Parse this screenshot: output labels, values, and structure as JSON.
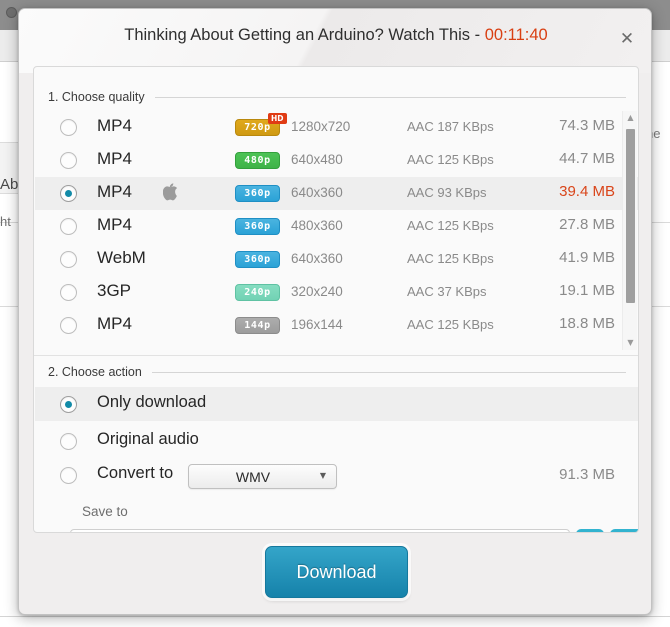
{
  "background": {
    "fragment_left_1": "Ab",
    "fragment_left_2": "ht",
    "fragment_right": "ne"
  },
  "dialog": {
    "title_text": "Thinking About Getting an Arduino? Watch This - ",
    "duration": "00:11:40",
    "close_icon": "✕",
    "accent_color": "#1682aa",
    "highlight_color": "#d9451a"
  },
  "quality_section": {
    "header": "1. Choose quality",
    "rows": [
      {
        "format": "MP4",
        "apple": false,
        "badge": "720p",
        "badge_style": "gold",
        "hd": "HD",
        "resolution": "1280x720",
        "codec": "AAC 187  KBps",
        "size": "74.3 MB",
        "selected": false
      },
      {
        "format": "MP4",
        "apple": false,
        "badge": "480p",
        "badge_style": "green",
        "hd": "",
        "resolution": "640x480",
        "codec": "AAC 125  KBps",
        "size": "44.7 MB",
        "selected": false
      },
      {
        "format": "MP4",
        "apple": true,
        "badge": "360p",
        "badge_style": "blue",
        "hd": "",
        "resolution": "640x360",
        "codec": "AAC 93  KBps",
        "size": "39.4 MB",
        "selected": true
      },
      {
        "format": "MP4",
        "apple": false,
        "badge": "360p",
        "badge_style": "blue",
        "hd": "",
        "resolution": "480x360",
        "codec": "AAC 125  KBps",
        "size": "27.8 MB",
        "selected": false
      },
      {
        "format": "WebM",
        "apple": false,
        "badge": "360p",
        "badge_style": "blue",
        "hd": "",
        "resolution": "640x360",
        "codec": "AAC 125  KBps",
        "size": "41.9 MB",
        "selected": false
      },
      {
        "format": "3GP",
        "apple": false,
        "badge": "240p",
        "badge_style": "mint",
        "hd": "",
        "resolution": "320x240",
        "codec": "AAC 37  KBps",
        "size": "19.1 MB",
        "selected": false
      },
      {
        "format": "MP4",
        "apple": false,
        "badge": "144p",
        "badge_style": "gray",
        "hd": "",
        "resolution": "196x144",
        "codec": "AAC 125  KBps",
        "size": "18.8 MB",
        "selected": false
      }
    ],
    "scrollbar": {
      "up_icon": "▲",
      "down_icon": "▼"
    }
  },
  "action_section": {
    "header": "2. Choose action",
    "only_download": "Only download",
    "original_audio": "Original audio",
    "convert_to": "Convert to",
    "convert_format": "WMV",
    "convert_caret": "▼",
    "convert_size": "91.3 MB",
    "save_to_label": "Save to"
  },
  "footer": {
    "download_label": "Download"
  }
}
